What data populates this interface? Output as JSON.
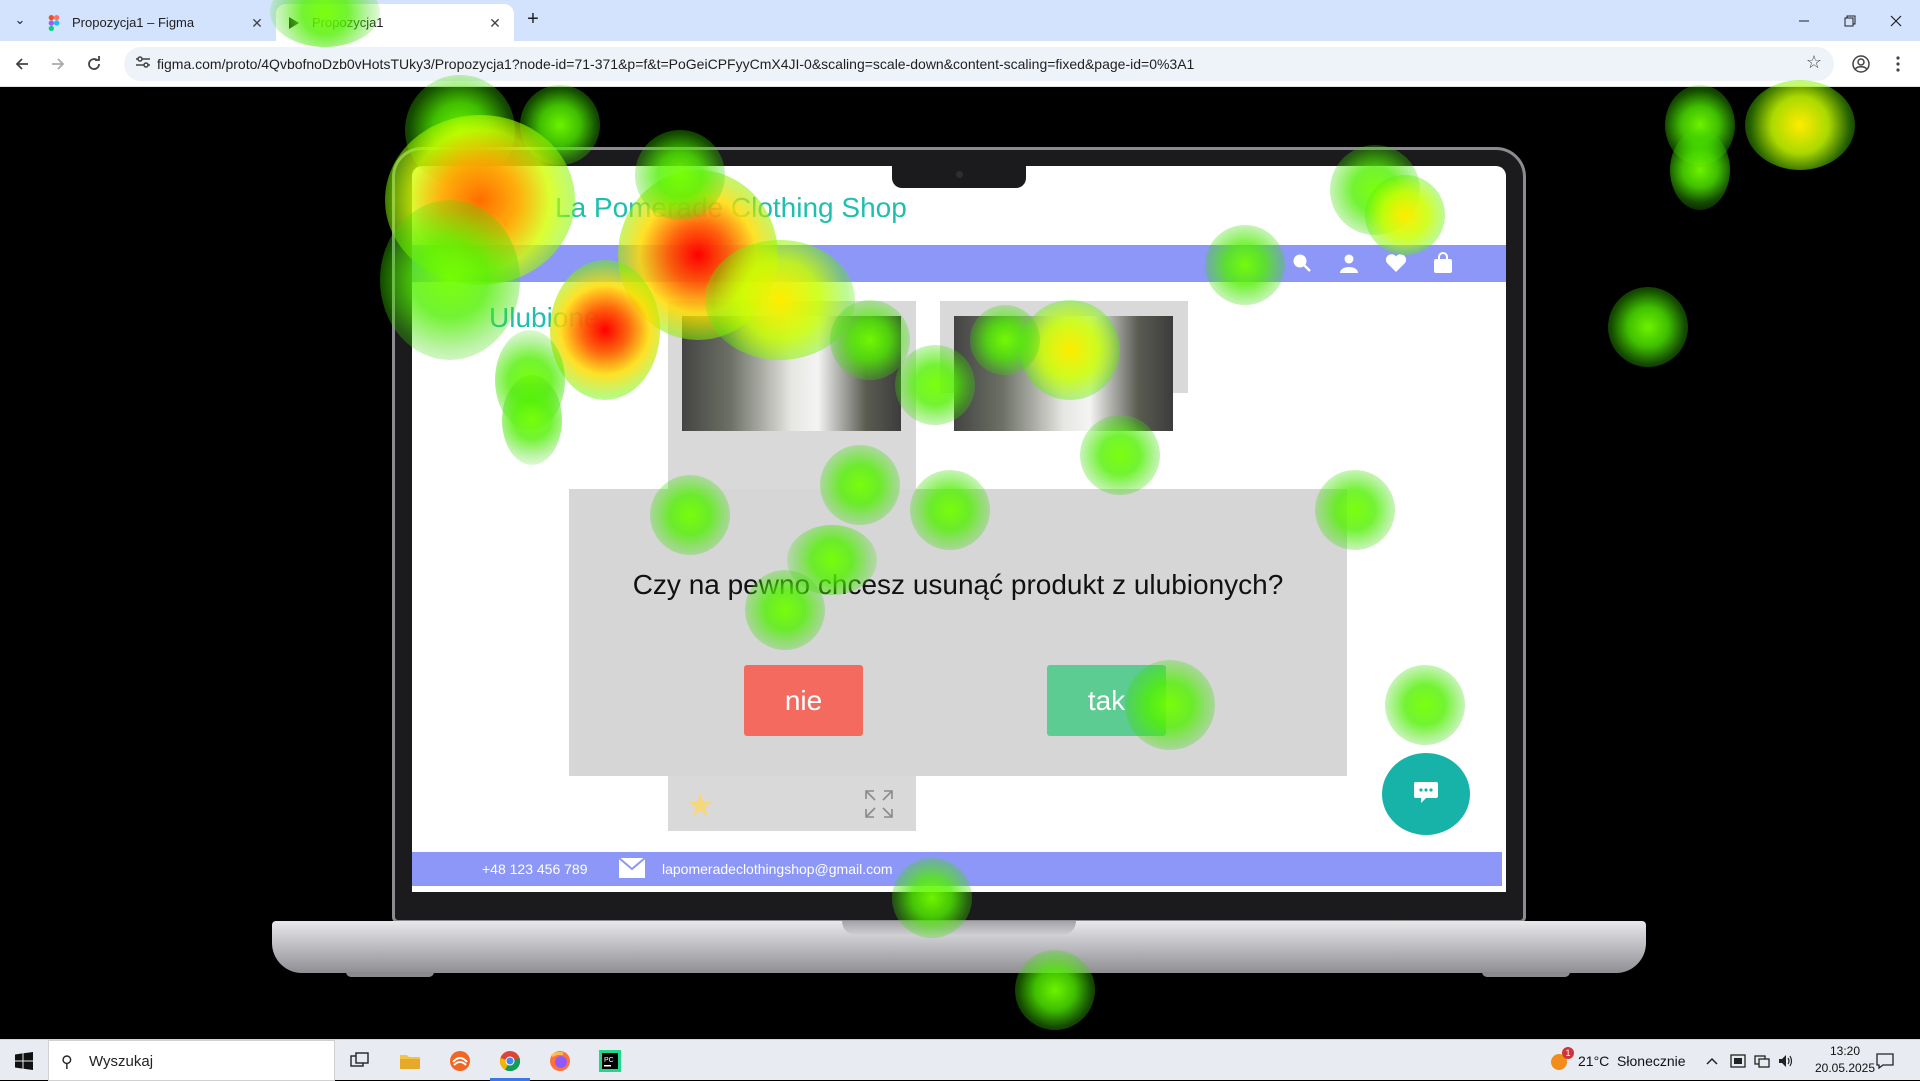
{
  "browser": {
    "tabs": [
      {
        "title": "Propozycja1 – Figma",
        "active": false
      },
      {
        "title": "Propozycja1",
        "active": true
      }
    ],
    "new_tab_label": "+",
    "url": "figma.com/proto/4QvbofnoDzb0vHotsTUky3/Propozycja1?node-id=71-371&p=f&t=PoGeiCPFyyCmX4JI-0&scaling=scale-down&content-scaling=fixed&page-id=0%3A1"
  },
  "shop": {
    "title": "La Pomerade Clothing Shop",
    "section_title": "Ulubione",
    "nav_icons": [
      "search-icon",
      "user-icon",
      "heart-icon",
      "bag-icon"
    ],
    "footer": {
      "phone": "+48 123 456 789",
      "email": "lapomeradeclothingshop@gmail.com"
    },
    "colors": {
      "accent": "#1fbfb0",
      "nav": "#8c97f7",
      "card": "#d9d9d9",
      "chat": "#17b3a8"
    }
  },
  "modal": {
    "question": "Czy na pewno chcesz usunąć produkt z ulubionych?",
    "no_label": "nie",
    "yes_label": "tak",
    "colors": {
      "no": "#f56a5e",
      "yes": "#5ccc93",
      "background": "#d6d6d6"
    }
  },
  "taskbar": {
    "search_placeholder": "Wyszukaj",
    "weather": "21°C  Słonecznie",
    "weather_badge": "1",
    "time": "13:20",
    "date": "20.05.2025"
  }
}
